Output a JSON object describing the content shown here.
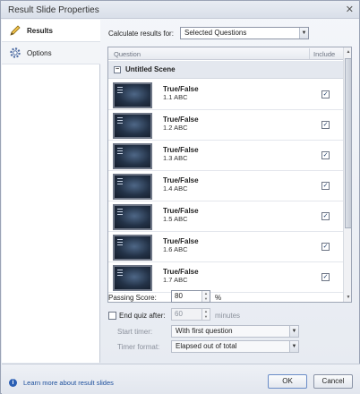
{
  "window": {
    "title": "Result Slide Properties",
    "close_glyph": "✕"
  },
  "sidebar": {
    "items": [
      {
        "label": "Results",
        "icon": "pencil-icon"
      },
      {
        "label": "Options",
        "icon": "gear-icon"
      }
    ]
  },
  "calc": {
    "label": "Calculate results for:",
    "value": "Selected Questions"
  },
  "list": {
    "header_question": "Question",
    "header_include": "Include",
    "scene": {
      "toggle": "−",
      "name": "Untitled Scene"
    },
    "rows": [
      {
        "title": "True/False",
        "sub": "1.1 ABC",
        "checked": "✓"
      },
      {
        "title": "True/False",
        "sub": "1.2 ABC",
        "checked": "✓"
      },
      {
        "title": "True/False",
        "sub": "1.3 ABC",
        "checked": "✓"
      },
      {
        "title": "True/False",
        "sub": "1.4 ABC",
        "checked": "✓"
      },
      {
        "title": "True/False",
        "sub": "1.5 ABC",
        "checked": "✓"
      },
      {
        "title": "True/False",
        "sub": "1.6 ABC",
        "checked": "✓"
      },
      {
        "title": "True/False",
        "sub": "1.7 ABC",
        "checked": "✓"
      }
    ]
  },
  "passing": {
    "label": "Passing Score:",
    "value": "80",
    "unit": "%"
  },
  "end_quiz": {
    "label": "End quiz after:",
    "value": "60",
    "unit": "minutes"
  },
  "start_timer": {
    "label": "Start timer:",
    "value": "With first question"
  },
  "timer_format": {
    "label": "Timer format:",
    "value": "Elapsed out of total"
  },
  "footer": {
    "learn_link": "Learn more about result slides",
    "ok_label": "OK",
    "cancel_label": "Cancel"
  }
}
